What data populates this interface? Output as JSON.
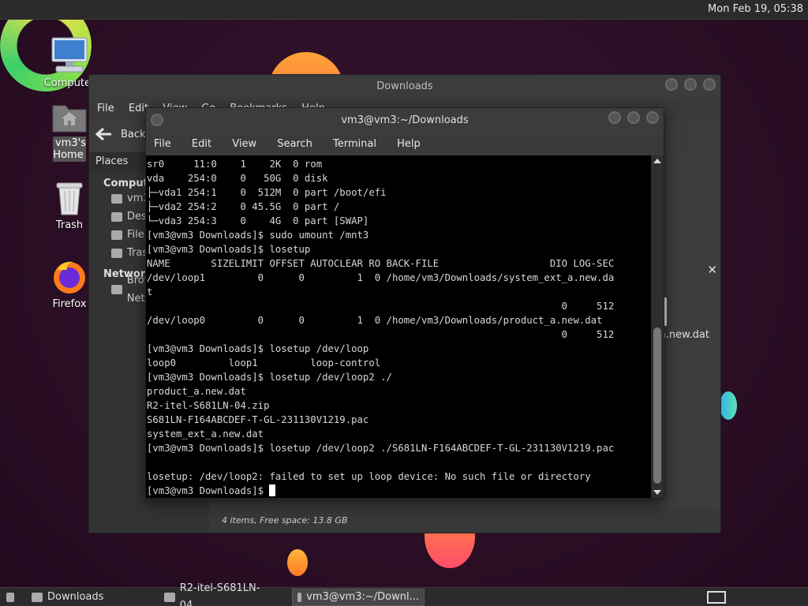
{
  "top_bar": {
    "clock": "Mon Feb 19, 05:38"
  },
  "desktop_icons": {
    "computer": "Computer",
    "home": "vm3's Home",
    "trash": "Trash",
    "firefox": "Firefox"
  },
  "file_manager": {
    "title": "Downloads",
    "menu": [
      "File",
      "Edit",
      "View",
      "Go",
      "Bookmarks",
      "Help"
    ],
    "back_label": "Back",
    "places_label": "Places",
    "sidebar": {
      "computer_heading": "Computer",
      "items": [
        "vm3's Home",
        "Desktop",
        "File System",
        "Trash"
      ],
      "network_heading": "Network",
      "network_items": [
        "Browse Network"
      ]
    },
    "file_fragment": "a.new.dat",
    "status": "4 items, Free space: 13.8 GB"
  },
  "terminal": {
    "title": "vm3@vm3:~/Downloads",
    "menu": [
      "File",
      "Edit",
      "View",
      "Search",
      "Terminal",
      "Help"
    ],
    "lines": [
      "sr0     11:0    1    2K  0 rom",
      "vda    254:0    0   50G  0 disk",
      "├─vda1 254:1    0  512M  0 part /boot/efi",
      "├─vda2 254:2    0 45.5G  0 part /",
      "└─vda3 254:3    0    4G  0 part [SWAP]",
      "[vm3@vm3 Downloads]$ sudo umount /mnt3",
      "[vm3@vm3 Downloads]$ losetup",
      "NAME       SIZELIMIT OFFSET AUTOCLEAR RO BACK-FILE                   DIO LOG-SEC",
      "/dev/loop1         0      0         1  0 /home/vm3/Downloads/system_ext_a.new.da",
      "t",
      "                                                                       0     512",
      "/dev/loop0         0      0         1  0 /home/vm3/Downloads/product_a.new.dat",
      "                                                                       0     512",
      "[vm3@vm3 Downloads]$ losetup /dev/loop",
      "loop0         loop1         loop-control",
      "[vm3@vm3 Downloads]$ losetup /dev/loop2 ./",
      "product_a.new.dat",
      "R2-itel-S681LN-04.zip",
      "S681LN-F164ABCDEF-T-GL-231130V1219.pac",
      "system_ext_a.new.dat",
      "[vm3@vm3 Downloads]$ losetup /dev/loop2 ./S681LN-F164ABCDEF-T-GL-231130V1219.pac",
      "",
      "losetup: /dev/loop2: failed to set up loop device: No such file or directory",
      "[vm3@vm3 Downloads]$ "
    ]
  },
  "taskbar": {
    "items": [
      "Downloads",
      "R2-itel-S681LN-04....",
      "vm3@vm3:~/Downl..."
    ]
  },
  "icons": {
    "computer": "computer-icon",
    "home": "home-folder-icon",
    "trash": "trash-icon",
    "firefox": "firefox-icon",
    "back": "back-arrow-icon"
  },
  "colors": {
    "panel": "#2b2b2b",
    "terminal_bg": "#000000",
    "terminal_fg": "#d8d8d8",
    "window": "#3a3a3a"
  }
}
